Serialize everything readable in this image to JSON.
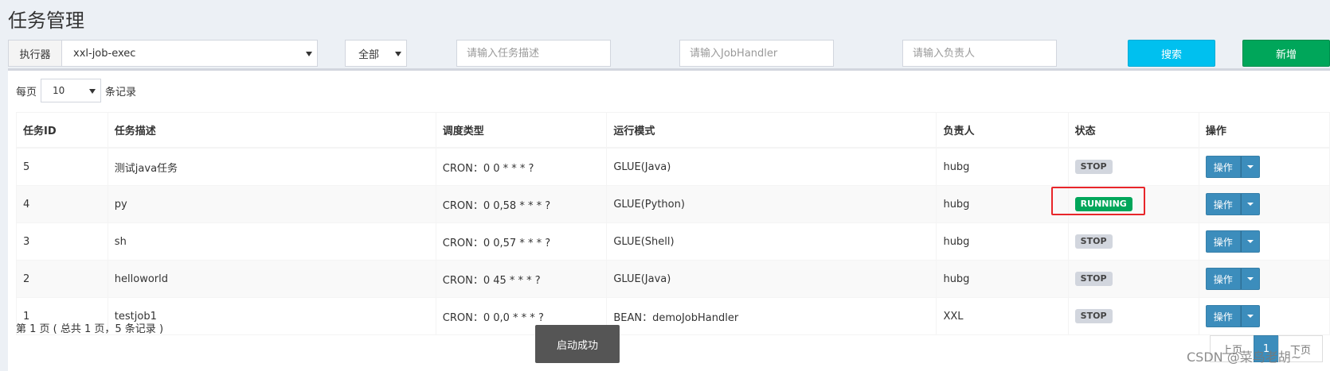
{
  "page": {
    "title": "任务管理"
  },
  "filter": {
    "executor_label": "执行器",
    "executor_value": "xxl-job-exec",
    "glue_type_value": "全部",
    "job_desc_placeholder": "请输入任务描述",
    "handler_placeholder": "请输入JobHandler",
    "author_placeholder": "请输入负责人",
    "search_label": "搜索",
    "add_label": "新增"
  },
  "length": {
    "prefix": "每页",
    "value": "10",
    "suffix": "条记录"
  },
  "table": {
    "headers": [
      "任务ID",
      "任务描述",
      "调度类型",
      "运行模式",
      "负责人",
      "状态",
      "操作"
    ],
    "rows": [
      {
        "id": "5",
        "desc": "测试java任务",
        "schedule": "CRON：0 0 * * * ?",
        "mode": "GLUE(Java)",
        "author": "hubg",
        "status": "STOP",
        "op": "操作"
      },
      {
        "id": "4",
        "desc": "py",
        "schedule": "CRON：0 0,58 * * * ?",
        "mode": "GLUE(Python)",
        "author": "hubg",
        "status": "RUNNING",
        "op": "操作"
      },
      {
        "id": "3",
        "desc": "sh",
        "schedule": "CRON：0 0,57 * * * ?",
        "mode": "GLUE(Shell)",
        "author": "hubg",
        "status": "STOP",
        "op": "操作"
      },
      {
        "id": "2",
        "desc": "helloworld",
        "schedule": "CRON：0 45 * * * ?",
        "mode": "GLUE(Java)",
        "author": "hubg",
        "status": "STOP",
        "op": "操作"
      },
      {
        "id": "1",
        "desc": "testjob1",
        "schedule": "CRON：0 0,0 * * * ?",
        "mode": "BEAN：demoJobHandler",
        "author": "XXL",
        "status": "STOP",
        "op": "操作"
      }
    ]
  },
  "info": {
    "text": "第 1 页 ( 总共 1 页，5 条记录 )"
  },
  "toast": {
    "text": "启动成功"
  },
  "pagination": {
    "prev": "上页",
    "current": "1",
    "next": "下页"
  },
  "watermark": {
    "text": "CSDN @菜鸟老胡~"
  },
  "colors": {
    "search": "#00c0ef",
    "add": "#00a65a",
    "op_button": "#3c8dbc",
    "running": "#00a65a",
    "stop": "#d2d6de",
    "highlight": "#e8262a"
  },
  "icons": {
    "dropdown": "caret-down-icon"
  }
}
